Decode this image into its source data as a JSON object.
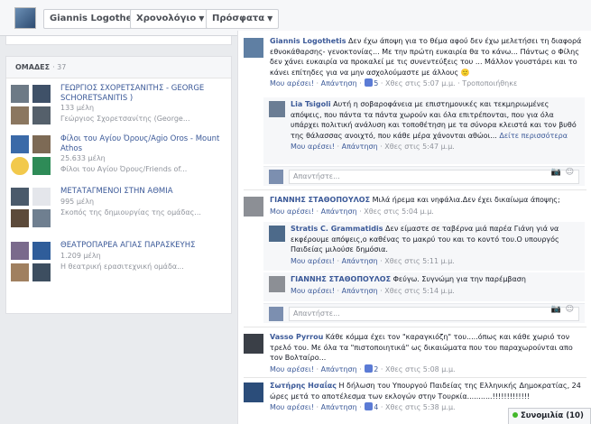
{
  "header": {
    "name": "Giannis Logothetis",
    "timeline": "Χρονολόγιο",
    "recent": "Πρόσφατα"
  },
  "groups": {
    "title": "ΟΜΑΔΕΣ",
    "count": "· 37",
    "items": [
      {
        "title": "ΓΕΩΡΓΙΟΣ ΣΧΟΡΕΤΣΑΝΙΤΗΣ - GEORGE SCHORETSANITIS )",
        "members": "133 μέλη",
        "desc": "Γεώργιος Σχορετσανίτης (George..."
      },
      {
        "title": "Φίλοι του Αγίου Όρους/Agio Oros - Mount Athos",
        "members": "25.633 μέλη",
        "desc": "Φίλοι του Αγίου Όρους/Friends of..."
      },
      {
        "title": "ΜΕΤΑΤΑΓΜΕΝΟΙ ΣΤΗΝ ΑΘΜΙΑ",
        "members": "995 μέλη",
        "desc": "Σκοπός της δημιουργίας της ομάδας..."
      },
      {
        "title": "ΘΕΑΤΡΟΠΑΡΕΑ ΑΓΙΑΣ ΠΑΡΑΣΚΕΥΗΣ",
        "members": "1.209 μέλη",
        "desc": "Η θεατρική ερασιτεχνική ομάδα..."
      }
    ]
  },
  "comments": {
    "c1": {
      "name": "Giannis Logothetis",
      "text": " Δεν έχω άποψη για το θέμα αφού δεν έχω μελετήσει τη διαφορά εθνοκάθαρσης- γενοκτονίας... Με την πρώτη ευκαιρία θα το κάνω... Πάντως ο Φίλης δεν χάνει ευκαιρία να προκαλεί με τις συνεντεύξεις του ... Μάλλον γουστάρει και το κάνει επίτηδες για να μην ασχολούμαστε με άλλους 🙂",
      "like": "Μου αρέσει!",
      "reply": "Απάντηση",
      "likes": "5",
      "time": "Χθες στις 5:07 μ.μ.",
      "edited": "Τροποποιήθηκε"
    },
    "r1": {
      "name": "Lia Tsigoli",
      "text": " Αυτή η σοβαροφάνεια με επιστημονικές και τεκμηριωμένες απόψεις, που πάντα τα πάντα χωρούν και όλα επιτρέπονται, που για όλα υπάρχει πολιτική ανάλυση και τοποθέτηση με τα σύνορα κλειστά και τον βυθό της θάλασσας ανοιχτό, που κάθε μέρα χάνονται αθώοι...",
      "more": "Δείτε περισσότερα",
      "like": "Μου αρέσει!",
      "reply": "Απάντηση",
      "time": "Χθες στις 5:47 μ.μ."
    },
    "input_placeholder": "Απαντήστε...",
    "c2": {
      "name": "ΓΙΑΝΝΗΣ ΣΤΑΘΟΠΟΥΛΟΣ",
      "text": " Μιλά ήρεμα και νηφάλια.Δεν έχει δικαίωμα άποψης;",
      "like": "Μου αρέσει!",
      "reply": "Απάντηση",
      "time": "Χθες στις 5:04 μ.μ."
    },
    "r2": {
      "name": "Stratis C. Grammatidis",
      "text": " Δεν είμαστε σε ταβέρνα μιά παρέα Γιάνη γιά να εκφέρουμε απόψεις,ο καθένας το μακρύ του και το κοντό του.Ο υπουργός Παιδείας μιλούσε δημόσια.",
      "like": "Μου αρέσει!",
      "reply": "Απάντηση",
      "time": "Χθες στις 5:11 μ.μ."
    },
    "r3": {
      "name": "ΓΙΑΝΝΗΣ ΣΤΑΘΟΠΟΥΛΟΣ",
      "text": " Φεύγω. Συγνώμη για την παρέμβαση",
      "like": "Μου αρέσει!",
      "reply": "Απάντηση",
      "time": "Χθες στις 5:14 μ.μ."
    },
    "c3": {
      "name": "Vasso Pyrrou",
      "text": " Κάθε κόμμα έχει τον \"καραγκιόζη\" του.....όπως και κάθε χωριό τον τρελό του. Με όλα τα \"πιστοποιητικά\" ως δικαιώματα που του παραχωρούνται απο τον Βολταίρο...",
      "like": "Μου αρέσει!",
      "reply": "Απάντηση",
      "likes": "2",
      "time": "Χθες στις 5:08 μ.μ."
    },
    "c4": {
      "name": "Σωτήρης Ησαΐας",
      "text": " Η δήλωση του Υπουργού Παιδείας της Ελληνικής Δημοκρατίας, 24 ώρες μετά το αποτέλεσμα των εκλογών στην Τουρκία...........!!!!!!!!!!!!!",
      "like": "Μου αρέσει!",
      "reply": "Απάντηση",
      "likes": "4",
      "time": "Χθες στις 5:38 μ.μ."
    }
  },
  "chat": {
    "label": "Συνομιλία (10)"
  },
  "colors": {
    "link": "#3b5998",
    "meta": "#90949c",
    "online": "#42b72a"
  }
}
